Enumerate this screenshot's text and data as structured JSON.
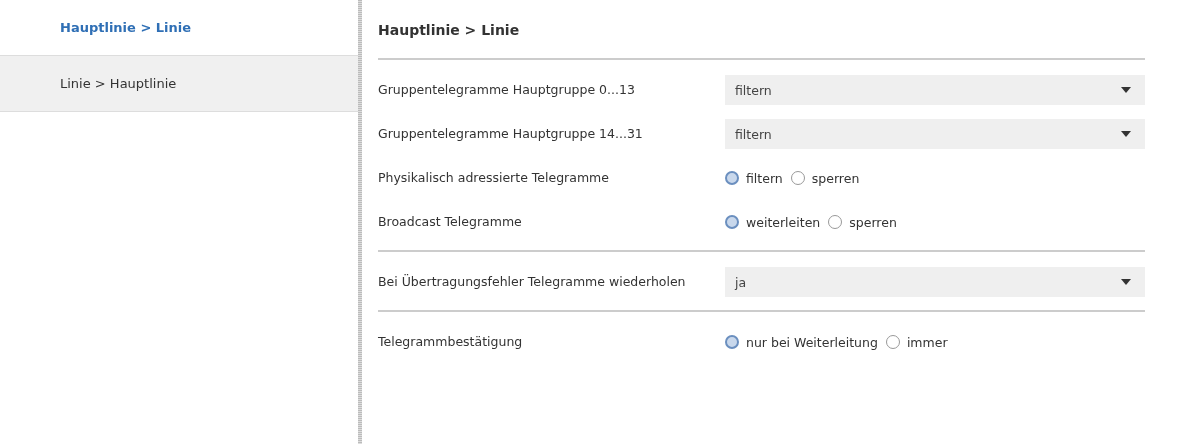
{
  "sidebar": {
    "items": [
      {
        "label": "Hauptlinie > Linie",
        "selected": true
      },
      {
        "label": "Linie > Hauptlinie",
        "selected": false
      }
    ]
  },
  "panel": {
    "title": "Hauptlinie > Linie",
    "rows": [
      {
        "kind": "separator"
      },
      {
        "kind": "dropdown",
        "label": "Gruppentelegramme Hauptgruppe 0...13",
        "value": "filtern"
      },
      {
        "kind": "dropdown",
        "label": "Gruppentelegramme Hauptgruppe 14...31",
        "value": "filtern"
      },
      {
        "kind": "radio",
        "label": "Physikalisch adressierte Telegramme",
        "options": [
          {
            "label": "filtern",
            "selected": true
          },
          {
            "label": "sperren",
            "selected": false
          }
        ]
      },
      {
        "kind": "radio",
        "label": "Broadcast Telegramme",
        "options": [
          {
            "label": "weiterleiten",
            "selected": true
          },
          {
            "label": "sperren",
            "selected": false
          }
        ]
      },
      {
        "kind": "separator"
      },
      {
        "kind": "dropdown",
        "label": "Bei Übertragungsfehler Telegramme wiederholen",
        "value": "ja"
      },
      {
        "kind": "separator"
      },
      {
        "kind": "radio",
        "label": "Telegrammbestätigung",
        "options": [
          {
            "label": "nur bei Weiterleitung",
            "selected": true
          },
          {
            "label": "immer",
            "selected": false
          }
        ]
      }
    ]
  }
}
